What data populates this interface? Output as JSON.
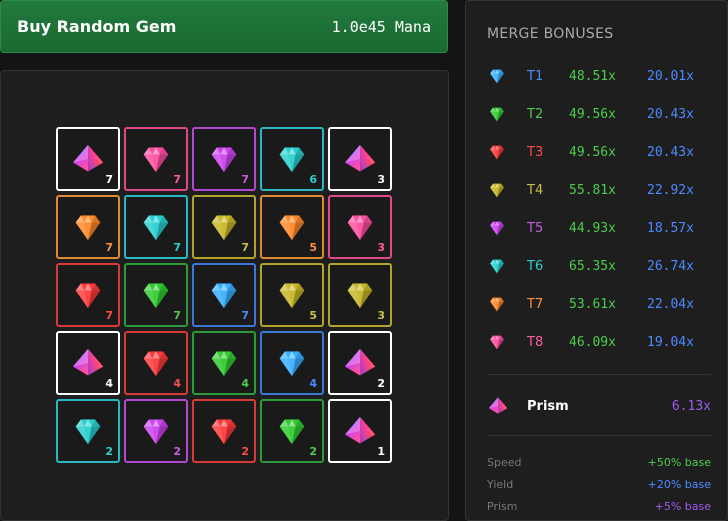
{
  "buy": {
    "label": "Buy Random Gem",
    "cost": "1.0e45 Mana"
  },
  "colors": {
    "T1": "#3ab0ff",
    "T2": "#33cc33",
    "T3": "#ff3b3b",
    "T4": "#c8b82a",
    "T5": "#cc44ee",
    "T6": "#2ad0d0",
    "T7": "#ff8a2a",
    "T8": "#ff4fa0",
    "prism": "#ffffff"
  },
  "border_colors": {
    "T1": "#3a78d8",
    "T2": "#2a9a3a",
    "T3": "#d83a3a",
    "T4": "#b0a42a",
    "T5": "#b048d0",
    "T6": "#2ab8c0",
    "T7": "#e08a30",
    "T8": "#e0488a",
    "prism": "#ffffff"
  },
  "count_colors": {
    "T1": "#4c8bff",
    "T2": "#4ccd4c",
    "T3": "#ff4c4c",
    "T4": "#c8c04c",
    "T5": "#c85ce0",
    "T6": "#2ad0d0",
    "T7": "#ff9040",
    "T8": "#ff5c9c",
    "prism": "#ffffff"
  },
  "grid": [
    [
      {
        "t": "prism",
        "n": "7"
      },
      {
        "t": "T8",
        "n": "7"
      },
      {
        "t": "T5",
        "n": "7"
      },
      {
        "t": "T6",
        "n": "6"
      },
      {
        "t": "prism",
        "n": "3"
      }
    ],
    [
      {
        "t": "T7",
        "n": "7"
      },
      {
        "t": "T6",
        "n": "7"
      },
      {
        "t": "T4",
        "n": "7"
      },
      {
        "t": "T7",
        "n": "5"
      },
      {
        "t": "T8",
        "n": "3"
      }
    ],
    [
      {
        "t": "T3",
        "n": "7"
      },
      {
        "t": "T2",
        "n": "7"
      },
      {
        "t": "T1",
        "n": "7"
      },
      {
        "t": "T4",
        "n": "5"
      },
      {
        "t": "T4",
        "n": "3"
      }
    ],
    [
      {
        "t": "prism",
        "n": "4"
      },
      {
        "t": "T3",
        "n": "4"
      },
      {
        "t": "T2",
        "n": "4"
      },
      {
        "t": "T1",
        "n": "4"
      },
      {
        "t": "prism",
        "n": "2"
      }
    ],
    [
      {
        "t": "T6",
        "n": "2"
      },
      {
        "t": "T5",
        "n": "2"
      },
      {
        "t": "T3",
        "n": "2"
      },
      {
        "t": "T2",
        "n": "2"
      },
      {
        "t": "prism",
        "n": "1"
      }
    ]
  ],
  "bonuses": {
    "title": "MERGE BONUSES",
    "rows": [
      {
        "tier": "T1",
        "m1": "48.51x",
        "m2": "20.01x"
      },
      {
        "tier": "T2",
        "m1": "49.56x",
        "m2": "20.43x"
      },
      {
        "tier": "T3",
        "m1": "49.56x",
        "m2": "20.43x"
      },
      {
        "tier": "T4",
        "m1": "55.81x",
        "m2": "22.92x"
      },
      {
        "tier": "T5",
        "m1": "44.93x",
        "m2": "18.57x"
      },
      {
        "tier": "T6",
        "m1": "65.35x",
        "m2": "26.74x"
      },
      {
        "tier": "T7",
        "m1": "53.61x",
        "m2": "22.04x"
      },
      {
        "tier": "T8",
        "m1": "46.09x",
        "m2": "19.04x"
      }
    ],
    "prism": {
      "label": "Prism",
      "value": "6.13x"
    },
    "stats": [
      {
        "label": "Speed",
        "value": "+50% base",
        "color": "#4ccd4c"
      },
      {
        "label": "Yield",
        "value": "+20% base",
        "color": "#4c8bff"
      },
      {
        "label": "Prism",
        "value": "+5% base",
        "color": "#a05cf0"
      }
    ]
  }
}
